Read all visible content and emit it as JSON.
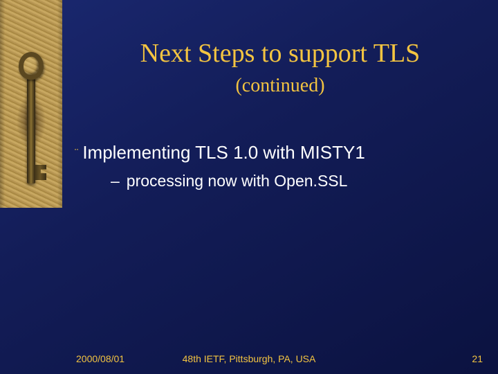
{
  "title": "Next Steps to support TLS",
  "subtitle": "(continued)",
  "bullets": {
    "level1": "Implementing TLS 1.0 with MISTY1",
    "level2": "processing now with Open.SSL"
  },
  "footer": {
    "date": "2000/08/01",
    "venue": "48th IETF, Pittsburgh, PA, USA",
    "page": "21"
  },
  "markers": {
    "bullet1": "¨",
    "bullet2": "–"
  }
}
